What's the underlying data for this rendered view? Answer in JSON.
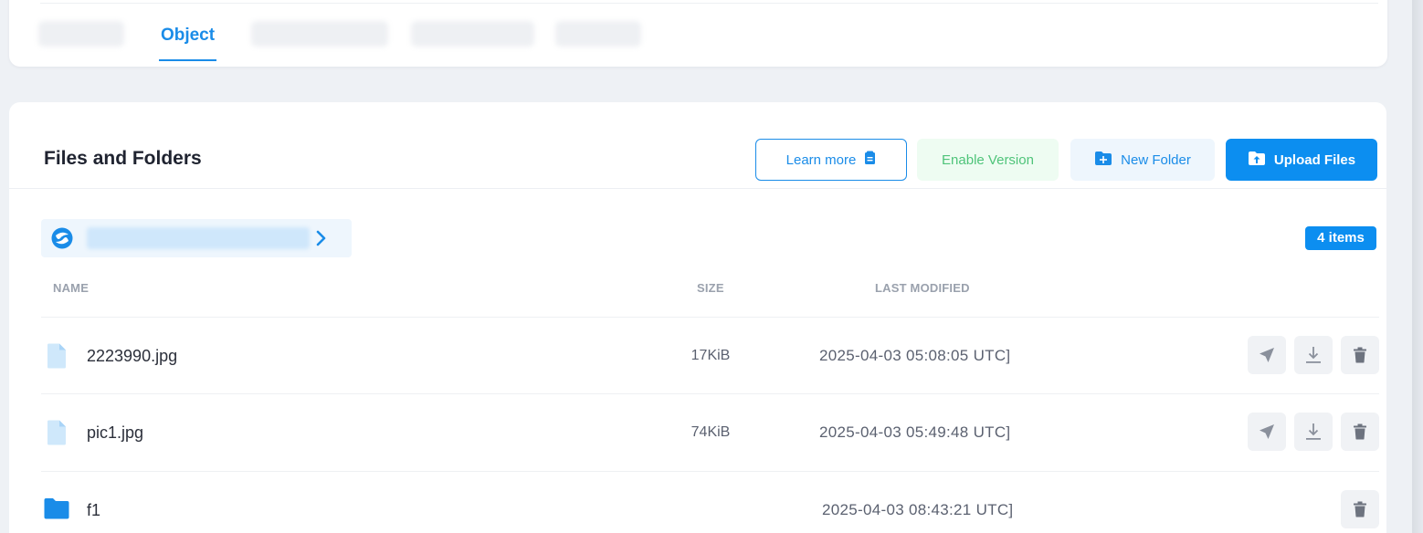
{
  "tabs": {
    "active_label": "Object"
  },
  "header": {
    "title": "Files and Folders"
  },
  "toolbar": {
    "learn_more_label": "Learn more",
    "enable_version_label": "Enable Version",
    "new_folder_label": "New Folder",
    "upload_files_label": "Upload Files"
  },
  "items_count": "4 items",
  "table": {
    "columns": {
      "name": "NAME",
      "size": "SIZE",
      "last_modified": "LAST MODIFIED"
    },
    "rows": [
      {
        "type": "file",
        "name": "2223990.jpg",
        "size": "17KiB",
        "modified": "2025-04-03 05:08:05 UTC]"
      },
      {
        "type": "file",
        "name": "pic1.jpg",
        "size": "74KiB",
        "modified": "2025-04-03 05:49:48 UTC]"
      },
      {
        "type": "folder",
        "name": "f1",
        "size": "",
        "modified": "2025-04-03 08:43:21 UTC]"
      }
    ]
  },
  "colors": {
    "accent": "#0c8ef0",
    "enable": "#4fc47a",
    "file_icon": "#cfe8fb",
    "folder_icon": "#1a8ce8"
  }
}
